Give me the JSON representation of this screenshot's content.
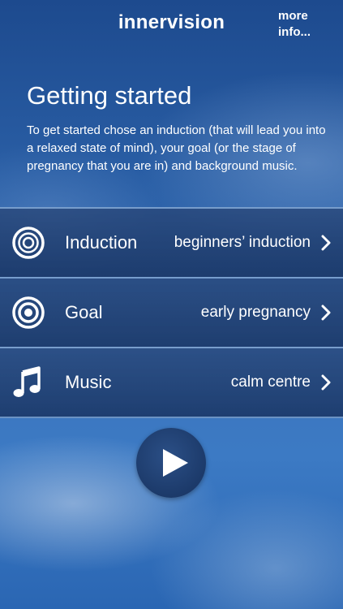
{
  "header": {
    "title": "innervision",
    "more_info_label": "more info..."
  },
  "intro": {
    "title": "Getting started",
    "text": "To get started chose an induction (that will lead you into a relaxed state of mind), your goal (or the stage of pregnancy that you are in) and background music."
  },
  "options": [
    {
      "label": "Induction",
      "value": "beginners’ induction",
      "icon": "concentric-rings-icon"
    },
    {
      "label": "Goal",
      "value": "early pregnancy",
      "icon": "target-icon"
    },
    {
      "label": "Music",
      "value": "calm centre",
      "icon": "music-note-icon"
    }
  ],
  "controls": {
    "play_icon": "play-icon"
  },
  "colors": {
    "text": "#ffffff",
    "row_background": "#1f3f72",
    "row_border": "#96bee b",
    "play_button": "#1c3a6a"
  }
}
